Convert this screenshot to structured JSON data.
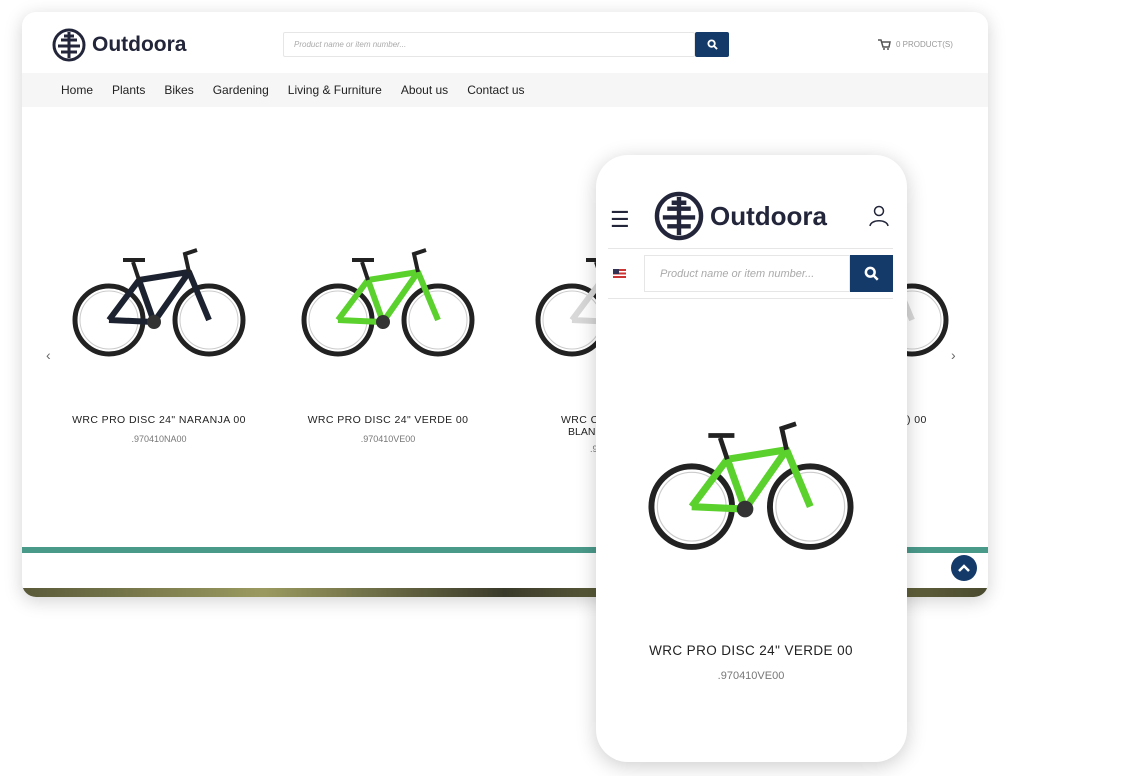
{
  "brand": {
    "name": "Outdoora",
    "color": "#23263a",
    "accent": "#143a6a",
    "teal": "#4a9a8a"
  },
  "desktop": {
    "search": {
      "placeholder": "Product name or item number..."
    },
    "cart": {
      "label": "0 PRODUCT(S)",
      "icon": "cart-icon"
    },
    "nav": [
      "Home",
      "Plants",
      "Bikes",
      "Gardening",
      "Living & Furniture",
      "About us",
      "Contact us"
    ],
    "products": [
      {
        "name": "WRC PRO DISC 24\" NARANJA 00",
        "code": ".970410NA00",
        "frame_color": "#1c2230"
      },
      {
        "name": "WRC PRO DISC 24\" VERDE 00",
        "code": ".970410VE00",
        "frame_color": "#5ad12c"
      },
      {
        "name": "WRC C",
        "name2": "BLAN",
        "code": ".9",
        "frame_color": "#d8d8d8"
      },
      {
        "name": ") 00",
        "code": "",
        "frame_color": "#d8d8d8"
      }
    ]
  },
  "mobile": {
    "search": {
      "placeholder": "Product name or item number..."
    },
    "product": {
      "name": "WRC PRO DISC 24\" VERDE 00",
      "code": ".970410VE00",
      "frame_color": "#5ad12c"
    }
  }
}
